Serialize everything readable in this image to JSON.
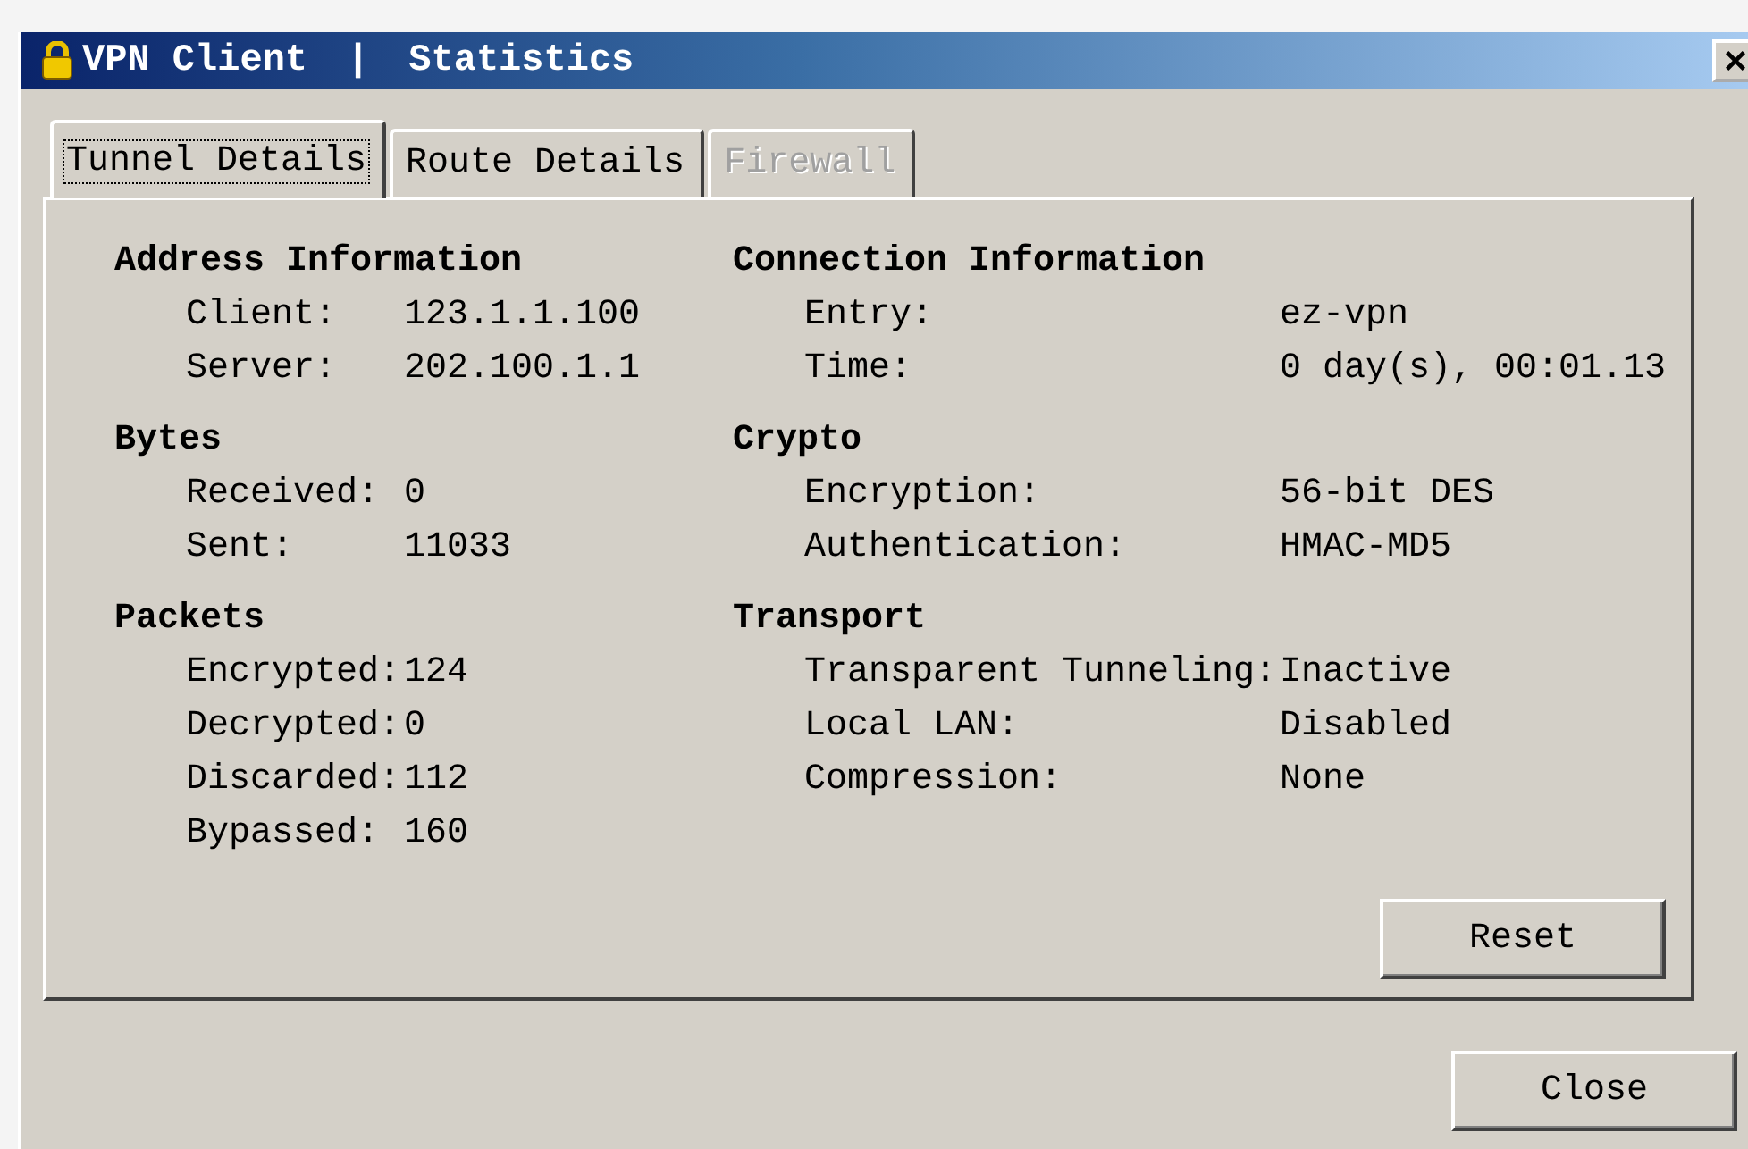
{
  "window": {
    "app": "VPN Client",
    "separator": "|",
    "title": "Statistics"
  },
  "tabs": [
    {
      "label": "Tunnel Details",
      "selected": true,
      "disabled": false
    },
    {
      "label": "Route Details",
      "selected": false,
      "disabled": false
    },
    {
      "label": "Firewall",
      "selected": false,
      "disabled": true
    }
  ],
  "columns": [
    [
      {
        "heading": "Address Information",
        "rows": [
          {
            "label": "Client:",
            "value": "123.1.1.100"
          },
          {
            "label": "Server:",
            "value": "202.100.1.1"
          }
        ]
      },
      {
        "heading": "Bytes",
        "rows": [
          {
            "label": "Received:",
            "value": "0"
          },
          {
            "label": "Sent:",
            "value": "11033"
          }
        ]
      },
      {
        "heading": "Packets",
        "rows": [
          {
            "label": "Encrypted:",
            "value": "124"
          },
          {
            "label": "Decrypted:",
            "value": "0"
          },
          {
            "label": "Discarded:",
            "value": "112"
          },
          {
            "label": "Bypassed:",
            "value": "160"
          }
        ]
      }
    ],
    [
      {
        "heading": "Connection Information",
        "rows": [
          {
            "label": "Entry:",
            "value": "ez-vpn"
          },
          {
            "label": "Time:",
            "value": "0 day(s), 00:01.13"
          }
        ]
      },
      {
        "heading": "Crypto",
        "rows": [
          {
            "label": "Encryption:",
            "value": "56-bit DES"
          },
          {
            "label": "Authentication:",
            "value": "HMAC-MD5"
          }
        ]
      },
      {
        "heading": "Transport",
        "rows": [
          {
            "label": "Transparent Tunneling:",
            "value": "Inactive"
          },
          {
            "label": "Local LAN:",
            "value": "Disabled"
          },
          {
            "label": "Compression:",
            "value": "None"
          }
        ]
      }
    ]
  ],
  "reset_button": "Reset",
  "close_button": "Close"
}
